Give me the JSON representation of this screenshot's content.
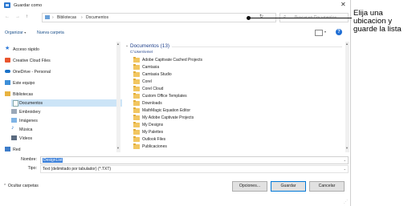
{
  "window": {
    "title": "Guardar como"
  },
  "nav": {
    "back": "←",
    "forward": "→",
    "up": "↑"
  },
  "address": {
    "crumbs": [
      "Bibliotecas",
      "Documentos"
    ],
    "search_placeholder": "Buscar en Documentos"
  },
  "toolbar": {
    "organize": "Organizar",
    "new_folder": "Nueva carpeta",
    "help": "?"
  },
  "sidebar": {
    "items": [
      {
        "label": "Acceso rápido",
        "icon": "star-icon"
      },
      {
        "label": "Creative Cloud Files",
        "icon": "creative-cloud-icon"
      },
      {
        "label": "OneDrive - Personal",
        "icon": "onedrive-icon"
      },
      {
        "label": "Este equipo",
        "icon": "computer-icon"
      },
      {
        "label": "Bibliotecas",
        "icon": "libraries-icon"
      },
      {
        "label": "Documentos",
        "icon": "documents-icon"
      },
      {
        "label": "Embroidery",
        "icon": "library-icon"
      },
      {
        "label": "Imágenes",
        "icon": "pictures-icon"
      },
      {
        "label": "Música",
        "icon": "music-icon"
      },
      {
        "label": "Vídeos",
        "icon": "videos-icon"
      },
      {
        "label": "Red",
        "icon": "network-icon"
      }
    ]
  },
  "content": {
    "group_header": "Documentos (13)",
    "group_path": "C:\\Users\\emet",
    "files": [
      "Adobe Captivate Cached Projects",
      "Camtasia",
      "Camtasia Studio",
      "Corel",
      "Corel Cloud",
      "Custom Office Templates",
      "Downloads",
      "MathMagic Equation Editor",
      "My Adobe Captivate Projects",
      "My Designs",
      "My Palettes",
      "Outlook Files",
      "Publicaciones"
    ]
  },
  "form": {
    "name_label": "Nombre:",
    "name_value": "DesignList",
    "type_label": "Tipo:",
    "type_value": "Text (delimitado por tabulador) (*.TXT)"
  },
  "footer": {
    "hide_folders": "Ocultar carpetas",
    "options": "Opciones...",
    "save": "Guardar",
    "cancel": "Cancelar"
  },
  "annotation": {
    "text": "Elija una ubicacion y guarde la lista"
  },
  "colors": {
    "accent": "#0078d7",
    "folder": "#f2c661",
    "selection": "#cce4f7"
  }
}
